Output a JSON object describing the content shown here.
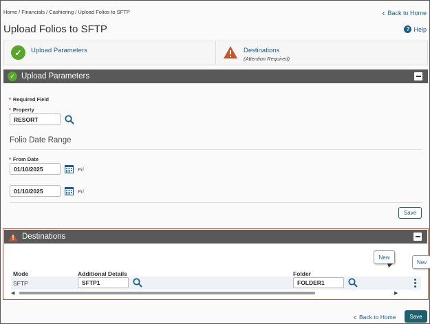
{
  "breadcrumb": "Home / Financials / Cashiering / Upload Folios to SFTP",
  "back_to_home": "Back to Home",
  "page_title": "Upload Folios to SFTP",
  "help": "Help",
  "steps": [
    {
      "label": "Upload Parameters",
      "sub": ""
    },
    {
      "label": "Destinations",
      "sub": "(Attention Required)"
    }
  ],
  "upload_panel": {
    "title": "Upload Parameters",
    "required_note": "Required Field",
    "property_label": "Property",
    "property_value": "RESORT",
    "folio_range_title": "Folio Date Range",
    "from_date_label": "From Date",
    "from_date_value": "01/10/2025",
    "from_day": "Fri",
    "to_date_value": "01/10/2025",
    "to_day": "Fri",
    "save_label": "Save"
  },
  "destinations_panel": {
    "title": "Destinations",
    "new_label": "New",
    "new_label_partial": "Nev",
    "columns": {
      "mode": "Mode",
      "additional": "Additional Details",
      "folder": "Folder"
    },
    "row": {
      "mode": "SFTP",
      "additional": "SFTP1",
      "folder": "FOLDER1"
    }
  },
  "footer": {
    "back_to_home": "Back to Home",
    "save_label": "Save"
  },
  "colors": {
    "accent": "#1a5d8e",
    "success": "#5aa62c",
    "warning": "#c4582b",
    "header": "#595959",
    "primary_button": "#1e5f6e"
  }
}
